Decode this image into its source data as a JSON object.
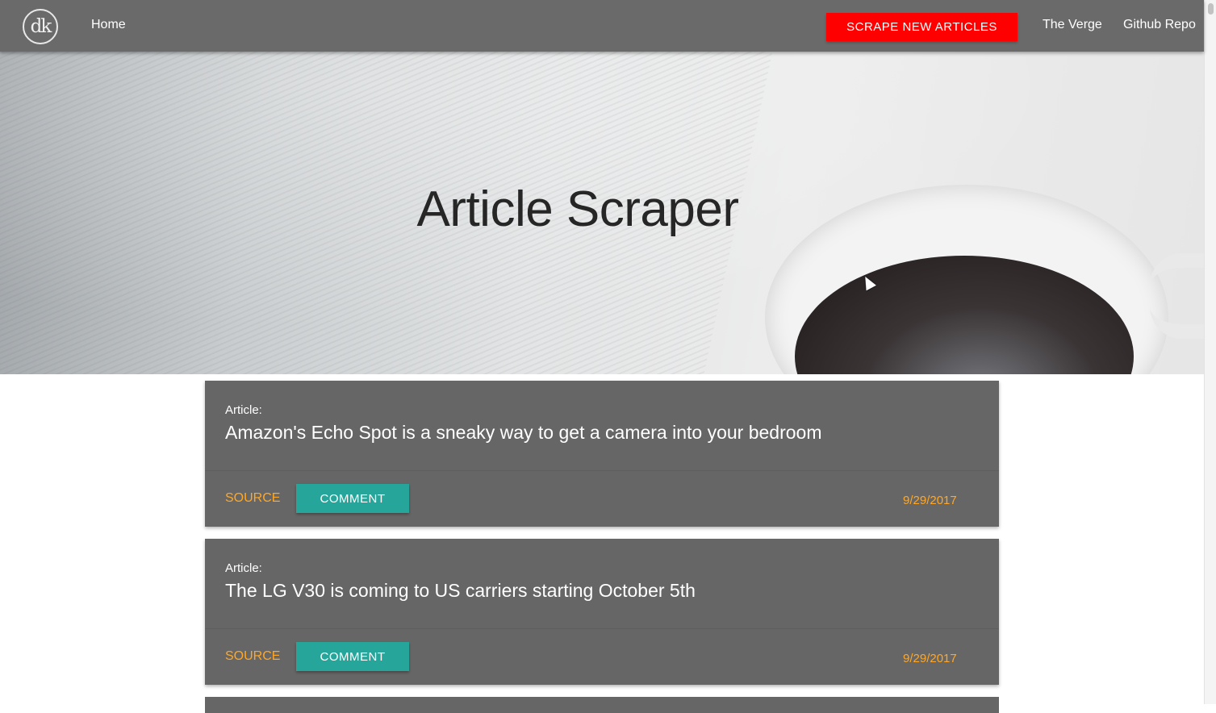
{
  "navbar": {
    "logo_text": "dk",
    "home_label": "Home",
    "scrape_label": "SCRAPE NEW ARTICLES",
    "verge_label": "The Verge",
    "github_label": "Github Repo",
    "scrape_color": "#ff0000"
  },
  "hero": {
    "title": "Article Scraper"
  },
  "articles": [
    {
      "label": "Article:",
      "title": "Amazon's Echo Spot is a sneaky way to get a camera into your bedroom",
      "source_label": "SOURCE",
      "comment_label": "COMMENT",
      "date": "9/29/2017"
    },
    {
      "label": "Article:",
      "title": "The LG V30 is coming to US carriers starting October 5th",
      "source_label": "SOURCE",
      "comment_label": "COMMENT",
      "date": "9/29/2017"
    }
  ],
  "colors": {
    "accent_orange": "#ffa726",
    "comment_teal": "#26a69a",
    "card_bg": "#666666",
    "navbar_bg": "#6a6a6a"
  }
}
